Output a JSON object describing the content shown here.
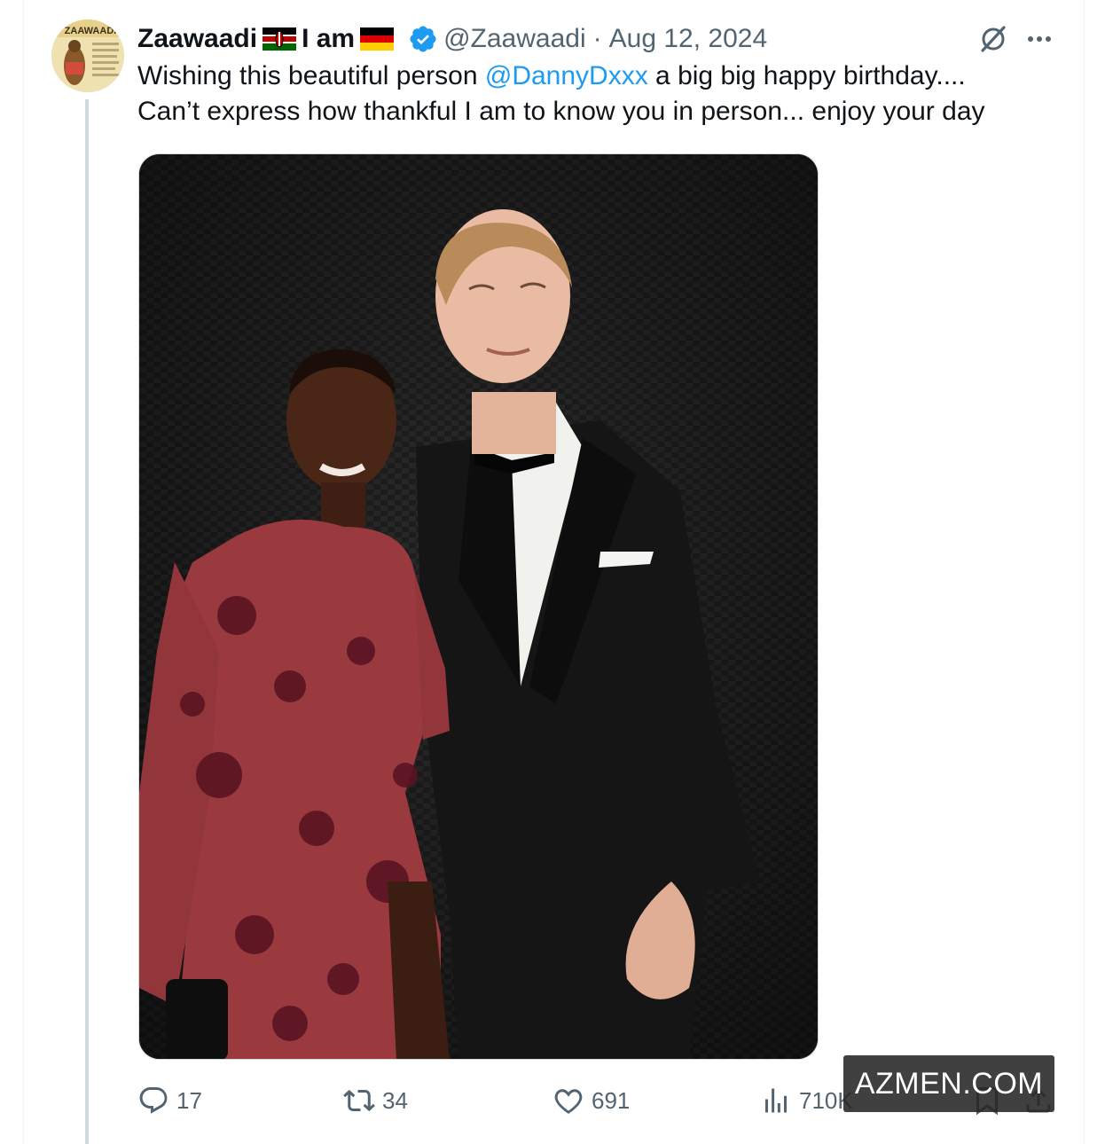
{
  "tweet": {
    "display_name": "Zaawaadi",
    "name_suffix": "I am",
    "handle": "@Zaawaadi",
    "separator": "·",
    "date": "Aug 12, 2024",
    "text_before_mention": "Wishing this beautiful person ",
    "mention": "@DannyDxxx",
    "text_after_mention": " a big big happy birthday....",
    "text_line2": "Can’t express how thankful I am to know you in person... enjoy your day",
    "avatar_label": "ZAAWAADI"
  },
  "actions": {
    "replies": "17",
    "reposts": "34",
    "likes": "691",
    "views": "710K"
  },
  "watermark": "AZMEN.COM",
  "colors": {
    "accent": "#1d9bf0",
    "secondary_text": "#536471",
    "primary_text": "#0f1419",
    "thread_line": "#cfd9de"
  },
  "icons": {
    "verified": "verified-badge-icon",
    "grok": "grok-icon",
    "more": "more-dots-icon",
    "reply": "reply-icon",
    "repost": "repost-icon",
    "like": "heart-icon",
    "views": "views-chart-icon",
    "bookmark": "bookmark-icon",
    "share": "share-icon"
  }
}
